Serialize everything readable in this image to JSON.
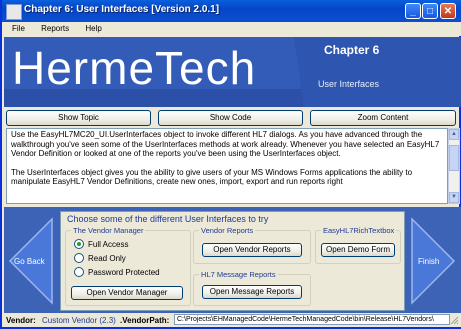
{
  "window": {
    "title": "Chapter 6: User Interfaces [Version 2.0.1]",
    "buttons": [
      "_",
      "□",
      "✕"
    ]
  },
  "menu": [
    "File",
    "Reports",
    "Help"
  ],
  "banner": {
    "logo": "HermeTech",
    "chapter": "Chapter 6",
    "subtitle": "User Interfaces"
  },
  "toolbar": {
    "show_topic": "Show Topic",
    "show_code": "Show Code",
    "zoom_content": "Zoom Content"
  },
  "content": {
    "p1": "Use the EasyHL7MC20_UI.UserInterfaces object to invoke different HL7 dialogs. As you have advanced through the walkthrough you've seen some of the UserInterfaces methods at work already. Whenever you have selected an EasyHL7 Vendor Definition or looked at one of the reports you've been using the UserInterfaces object.",
    "p2": "The UserInterfaces object gives you the ability to give users of your MS Windows Forms applications the ability to manipulate EasyHL7 Vendor Definitions, create new ones, import, export and run reports right"
  },
  "nav": {
    "back": "Go Back",
    "finish": "Finish"
  },
  "panel": {
    "title": "Choose some of the different User Interfaces to try",
    "vendor_manager": {
      "label": "The Vendor Manager",
      "options": [
        "Full Access",
        "Read Only",
        "Password Protected"
      ],
      "selected": "Full Access",
      "button": "Open Vendor Manager"
    },
    "vendor_reports": {
      "label": "Vendor Reports",
      "button": "Open Vendor Reports"
    },
    "rich_textbox": {
      "label": "EasyHL7RichTextbox",
      "button": "Open Demo Form"
    },
    "message_reports": {
      "label": "HL7 Message Reports",
      "button": "Open Message Reports"
    }
  },
  "status": {
    "vendor_label": "Vendor:",
    "vendor_value": "Custom Vendor (2.3)",
    "path_label": ".VendorPath:",
    "path_value": "C:\\Projects\\EHManagedCode\\HermeTechManagedCode\\bin\\Release\\HL7Vendors\\"
  },
  "colors": {
    "title_bar": "#0546c7",
    "banner": "#335bb8",
    "panel_bg": "#3d63b6",
    "arrow": "#4a78d8",
    "accent_text": "#1f3a93"
  }
}
